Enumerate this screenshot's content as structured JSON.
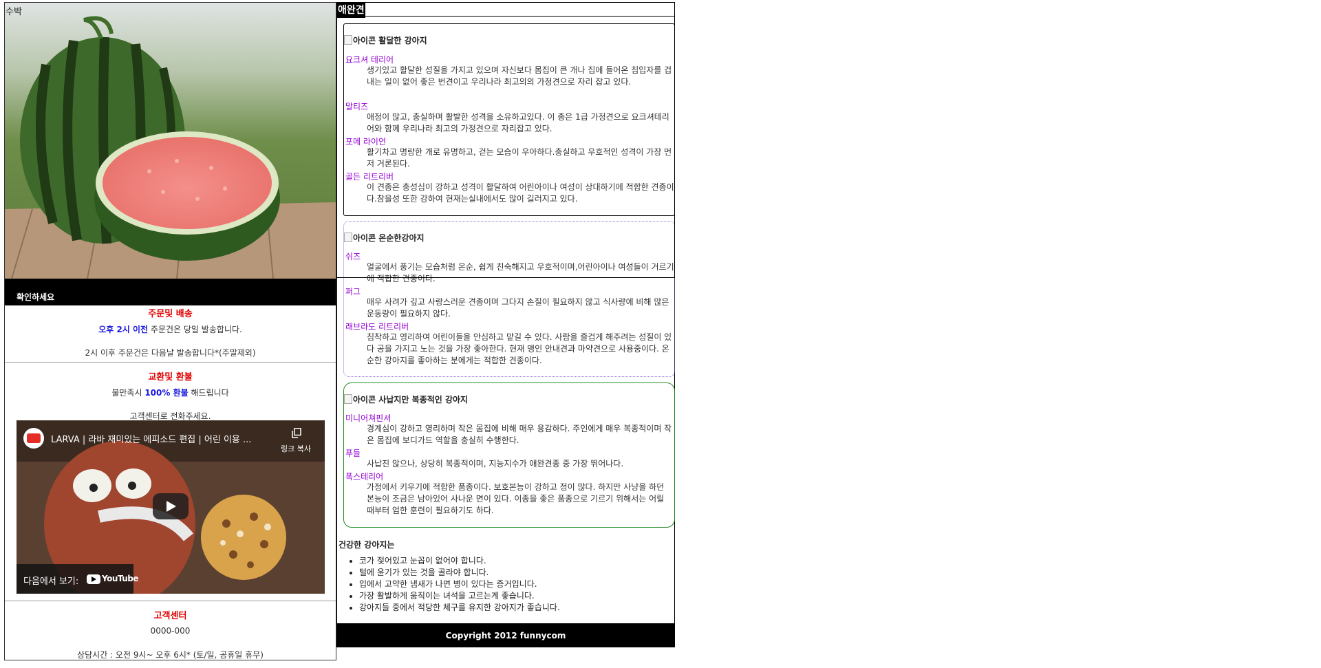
{
  "hero": {
    "alt_text": "수박"
  },
  "notice": {
    "title": "확인하세요",
    "order": {
      "title": "주문및 배송",
      "line1_highlight": "오후 2시 이전",
      "line1_rest": " 주문건은 당일 발송합니다.",
      "line2": "2시 이후 주문건은 다음날 발송합니다*(주말제외)"
    },
    "refund": {
      "title": "교환및 환불",
      "line1_pre": "불만족시 ",
      "line1_highlight": "100% 환불",
      "line1_post": " 해드립니다",
      "line2": "고객센터로 전화주세요."
    },
    "video": {
      "title": "LARVA | 라바 재미있는 에피소드 편집 | 어린 이용 ...",
      "copy_label": "링크 복사",
      "watch_on": "다음에서 보기:",
      "platform": "YouTube"
    },
    "center": {
      "title": "고객센터",
      "phone": "0000-000",
      "hours": "상담시간 : 오전 9시~ 오후 6시* (토/일, 공휴일 휴무)"
    }
  },
  "main": {
    "heading": "애완견",
    "groups": [
      {
        "icon_alt": "아이콘 활달한 강아지",
        "items": [
          {
            "name": "요크셔 테리어",
            "desc": "생기있고 활달한 성질을 가지고 있으며 자신보다 몸집이 큰 개나 집에 들어온 침입자를 겁내는 일이 없어 좋은 번견이고 우리나라 최고의의 가정견으로 자리 잡고 있다."
          },
          {
            "name": "말티즈",
            "desc": "애정이 많고, 충실하며 활발한 성격을 소유하고있다. 이 종은 1급 가정견으로 요크셔테리어와 함께 우리나라 최고의 가정견으로 자리잡고 있다."
          },
          {
            "name": "포메 라이언",
            "desc": "활기차고 명랑한 개로 유명하고, 걷는 모습이 우아하다.충실하고 우호적인 성격이 가장 먼저 거론된다."
          },
          {
            "name": "골든 리트리버",
            "desc": "이 견종은 충성심이 강하고 성격이 활달하여 어린아이나 여성이 상대하기에 적합한 견종이다.참을성 또한 강하여 현재는실내에서도 많이 길러지고 있다."
          }
        ]
      },
      {
        "icon_alt": "아이콘 온순한강아지",
        "items": [
          {
            "name": "쉬즈",
            "desc": "얼굴에서 풍기는 모습처럼 온순, 쉽게 친숙해지고 우호적이며,어린아이나 여성들이 거르기에 적합한 견종이다."
          },
          {
            "name": "퍼그",
            "desc": "매우 사려가 깊고 사랑스러운 견종이며 그다지 손질이 필요하지 않고 식사량에 비해 많은 운동량이 필요하지 않다."
          },
          {
            "name": "래브라도 리트리버",
            "desc": "침착하고 영리하여 어린이들을 안심하고 맡길 수 있다. 사람을 즐겁게 해주려는 성질이 있다 공을 가지고 노는 것을 가장 좋아한다. 현재 맹인 안내견과 마약견으로 사용중이다. 온순한 강아지를 좋아하는 분에게는 적합한 견종이다."
          }
        ]
      },
      {
        "icon_alt": "아이콘 사납지만 복종적인 강아지",
        "items": [
          {
            "name": "미니어쳐핀셔",
            "desc": "경계심이 강하고 영리하며 작은 몸집에 비해 매우 용감하다. 주인에게 매우 복종적이며 작은 몸집에 보디가드 역할을 충실히 수행한다."
          },
          {
            "name": "푸들",
            "desc": "사납진 않으나, 상당히 복종적이며, 지능지수가 애완견종 중 가장 뛰어나다."
          },
          {
            "name": "폭스테리어",
            "desc": "가정에서 키우기에 적합한 품종이다. 보호본능이 강하고 정이 많다. 하지만 사냥을 하던 본능이 조금은 남아있어 사나운 면이 있다. 이종을 좋은 품종으로 기르기 위해서는 어릴 때부터 엄한 훈련이 필요하기도 하다."
          }
        ]
      }
    ],
    "healthy": {
      "title": "건강한 강아지는",
      "items": [
        "코가 젖어있고 눈꼽이 없어야 합니다.",
        "털에 윤기가 있는 것을 골라야 합니다.",
        "입에서 고약한 냄새가 나면 병이 있다는 증거입니다.",
        "가장 활발하게 움직이는 녀석을 고르는게 좋습니다.",
        "강아지들 중에서 적당한 체구를 유지한 강아지가 좋습니다."
      ]
    },
    "footer": "Copyright 2012 funnycom"
  }
}
